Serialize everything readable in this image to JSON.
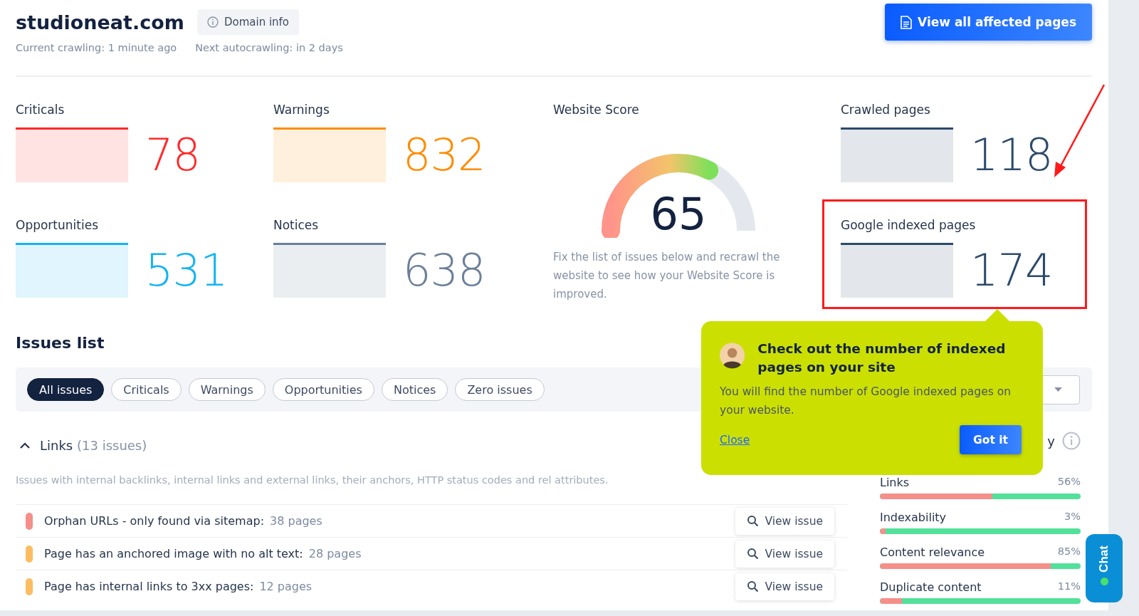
{
  "header": {
    "domain": "studioneat.com",
    "domain_info_button": "Domain info",
    "current_crawling": "Current crawling: 1 minute ago",
    "next_autocrawling": "Next autocrawling: in 2 days",
    "primary_button": "View all affected pages"
  },
  "metrics": [
    {
      "label": "Criticals",
      "value": "78",
      "color": "#ff2a2a"
    },
    {
      "label": "Warnings",
      "value": "832",
      "color": "#ff8c00"
    },
    {
      "label": "Crawled pages",
      "value": "118",
      "color": "#2c4a6b"
    },
    {
      "label": "Opportunities",
      "value": "531",
      "color": "#14b4f0"
    },
    {
      "label": "Notices",
      "value": "638",
      "color": "#6b7f99"
    },
    {
      "label": "Google indexed pages",
      "value": "174",
      "color": "#2c4a6b"
    }
  ],
  "website_score": {
    "title": "Website Score",
    "score": "65",
    "level": 0.65,
    "description": "Fix the list of issues below and recrawl the website to see how your Website Score is improved."
  },
  "issues_list": {
    "title": "Issues list",
    "filters": [
      {
        "label": "All issues",
        "selected": true
      },
      {
        "label": "Criticals",
        "selected": false
      },
      {
        "label": "Warnings",
        "selected": false
      },
      {
        "label": "Opportunities",
        "selected": false
      },
      {
        "label": "Notices",
        "selected": false
      },
      {
        "label": "Zero issues",
        "selected": false
      }
    ],
    "group": {
      "name": "Links",
      "count": "(13 issues)",
      "expanded": true,
      "description": "Issues with internal backlinks, internal links and external links, their anchors, HTTP status codes and rel attributes.",
      "issues": [
        {
          "title": "Orphan URLs - only found via sitemap:",
          "pages": "38 pages",
          "color": "#f58f8a",
          "action": "View issue"
        },
        {
          "title": "Page has an anchored image with no alt text:",
          "pages": "28 pages",
          "color": "#fbbd5f",
          "action": "View issue"
        },
        {
          "title": "Page has internal links to 3xx pages:",
          "pages": "12 pages",
          "color": "#fbbd5f",
          "action": "View issue"
        }
      ]
    }
  },
  "categories": {
    "heading_fragment": "y",
    "items": [
      {
        "name": "Links",
        "percent": "56%",
        "level": 0.56
      },
      {
        "name": "Indexability",
        "percent": "3%",
        "level": 0.03
      },
      {
        "name": "Content relevance",
        "percent": "85%",
        "level": 0.85
      },
      {
        "name": "Duplicate content",
        "percent": "11%",
        "level": 0.11
      }
    ]
  },
  "tooltip": {
    "title": "Check out the number of indexed pages on your site",
    "text": "You will find the number of Google indexed pages on your website.",
    "close_link": "Close",
    "confirm_button": "Got it"
  },
  "chat_button": {
    "label": "Chat",
    "online": true
  }
}
